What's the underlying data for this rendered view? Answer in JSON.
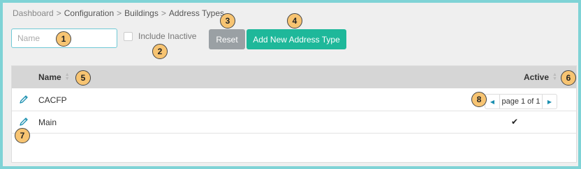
{
  "breadcrumb": {
    "items": [
      "Dashboard",
      "Configuration",
      "Buildings",
      "Address Types"
    ],
    "separator": ">"
  },
  "filters": {
    "name_placeholder": "Name",
    "include_inactive_label": "Include Inactive"
  },
  "toolbar": {
    "reset_label": "Reset",
    "add_label": "Add New Address Type"
  },
  "table": {
    "columns": {
      "name": "Name",
      "active": "Active"
    },
    "rows": [
      {
        "name": "CACFP",
        "active": "✔"
      },
      {
        "name": "Main",
        "active": "✔"
      }
    ]
  },
  "pagination": {
    "text": "page 1 of 1"
  },
  "markers": [
    "1",
    "2",
    "3",
    "4",
    "5",
    "6",
    "7",
    "8"
  ],
  "colors": {
    "accent": "#1eb89a",
    "reset": "#9aa0a4",
    "frame": "#7fd3d6",
    "marker": "#f7c472"
  }
}
